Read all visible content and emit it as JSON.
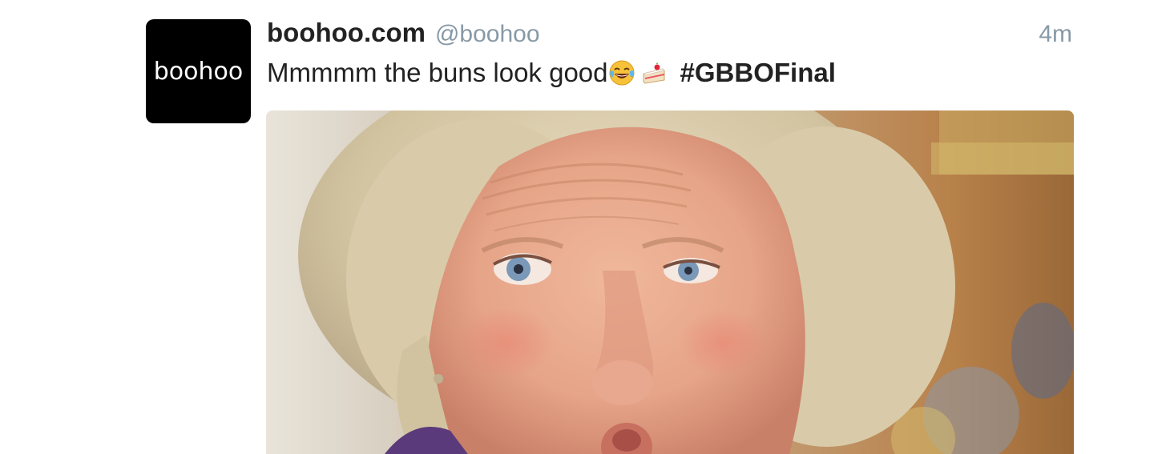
{
  "tweet": {
    "author": {
      "avatar_text": "boohoo",
      "display_name": "boohoo.com",
      "handle": "@boohoo"
    },
    "timestamp": "4m",
    "text": {
      "body": "Mmmmm the buns look good",
      "emojis": [
        "face-with-tears-of-joy-icon",
        "shortcake-icon"
      ],
      "hashtag": "#GBBOFinal"
    },
    "media": {
      "kind": "photo"
    }
  },
  "colors": {
    "avatar_bg": "#000000",
    "primary_text": "#222222",
    "secondary_text": "#8899a6"
  }
}
